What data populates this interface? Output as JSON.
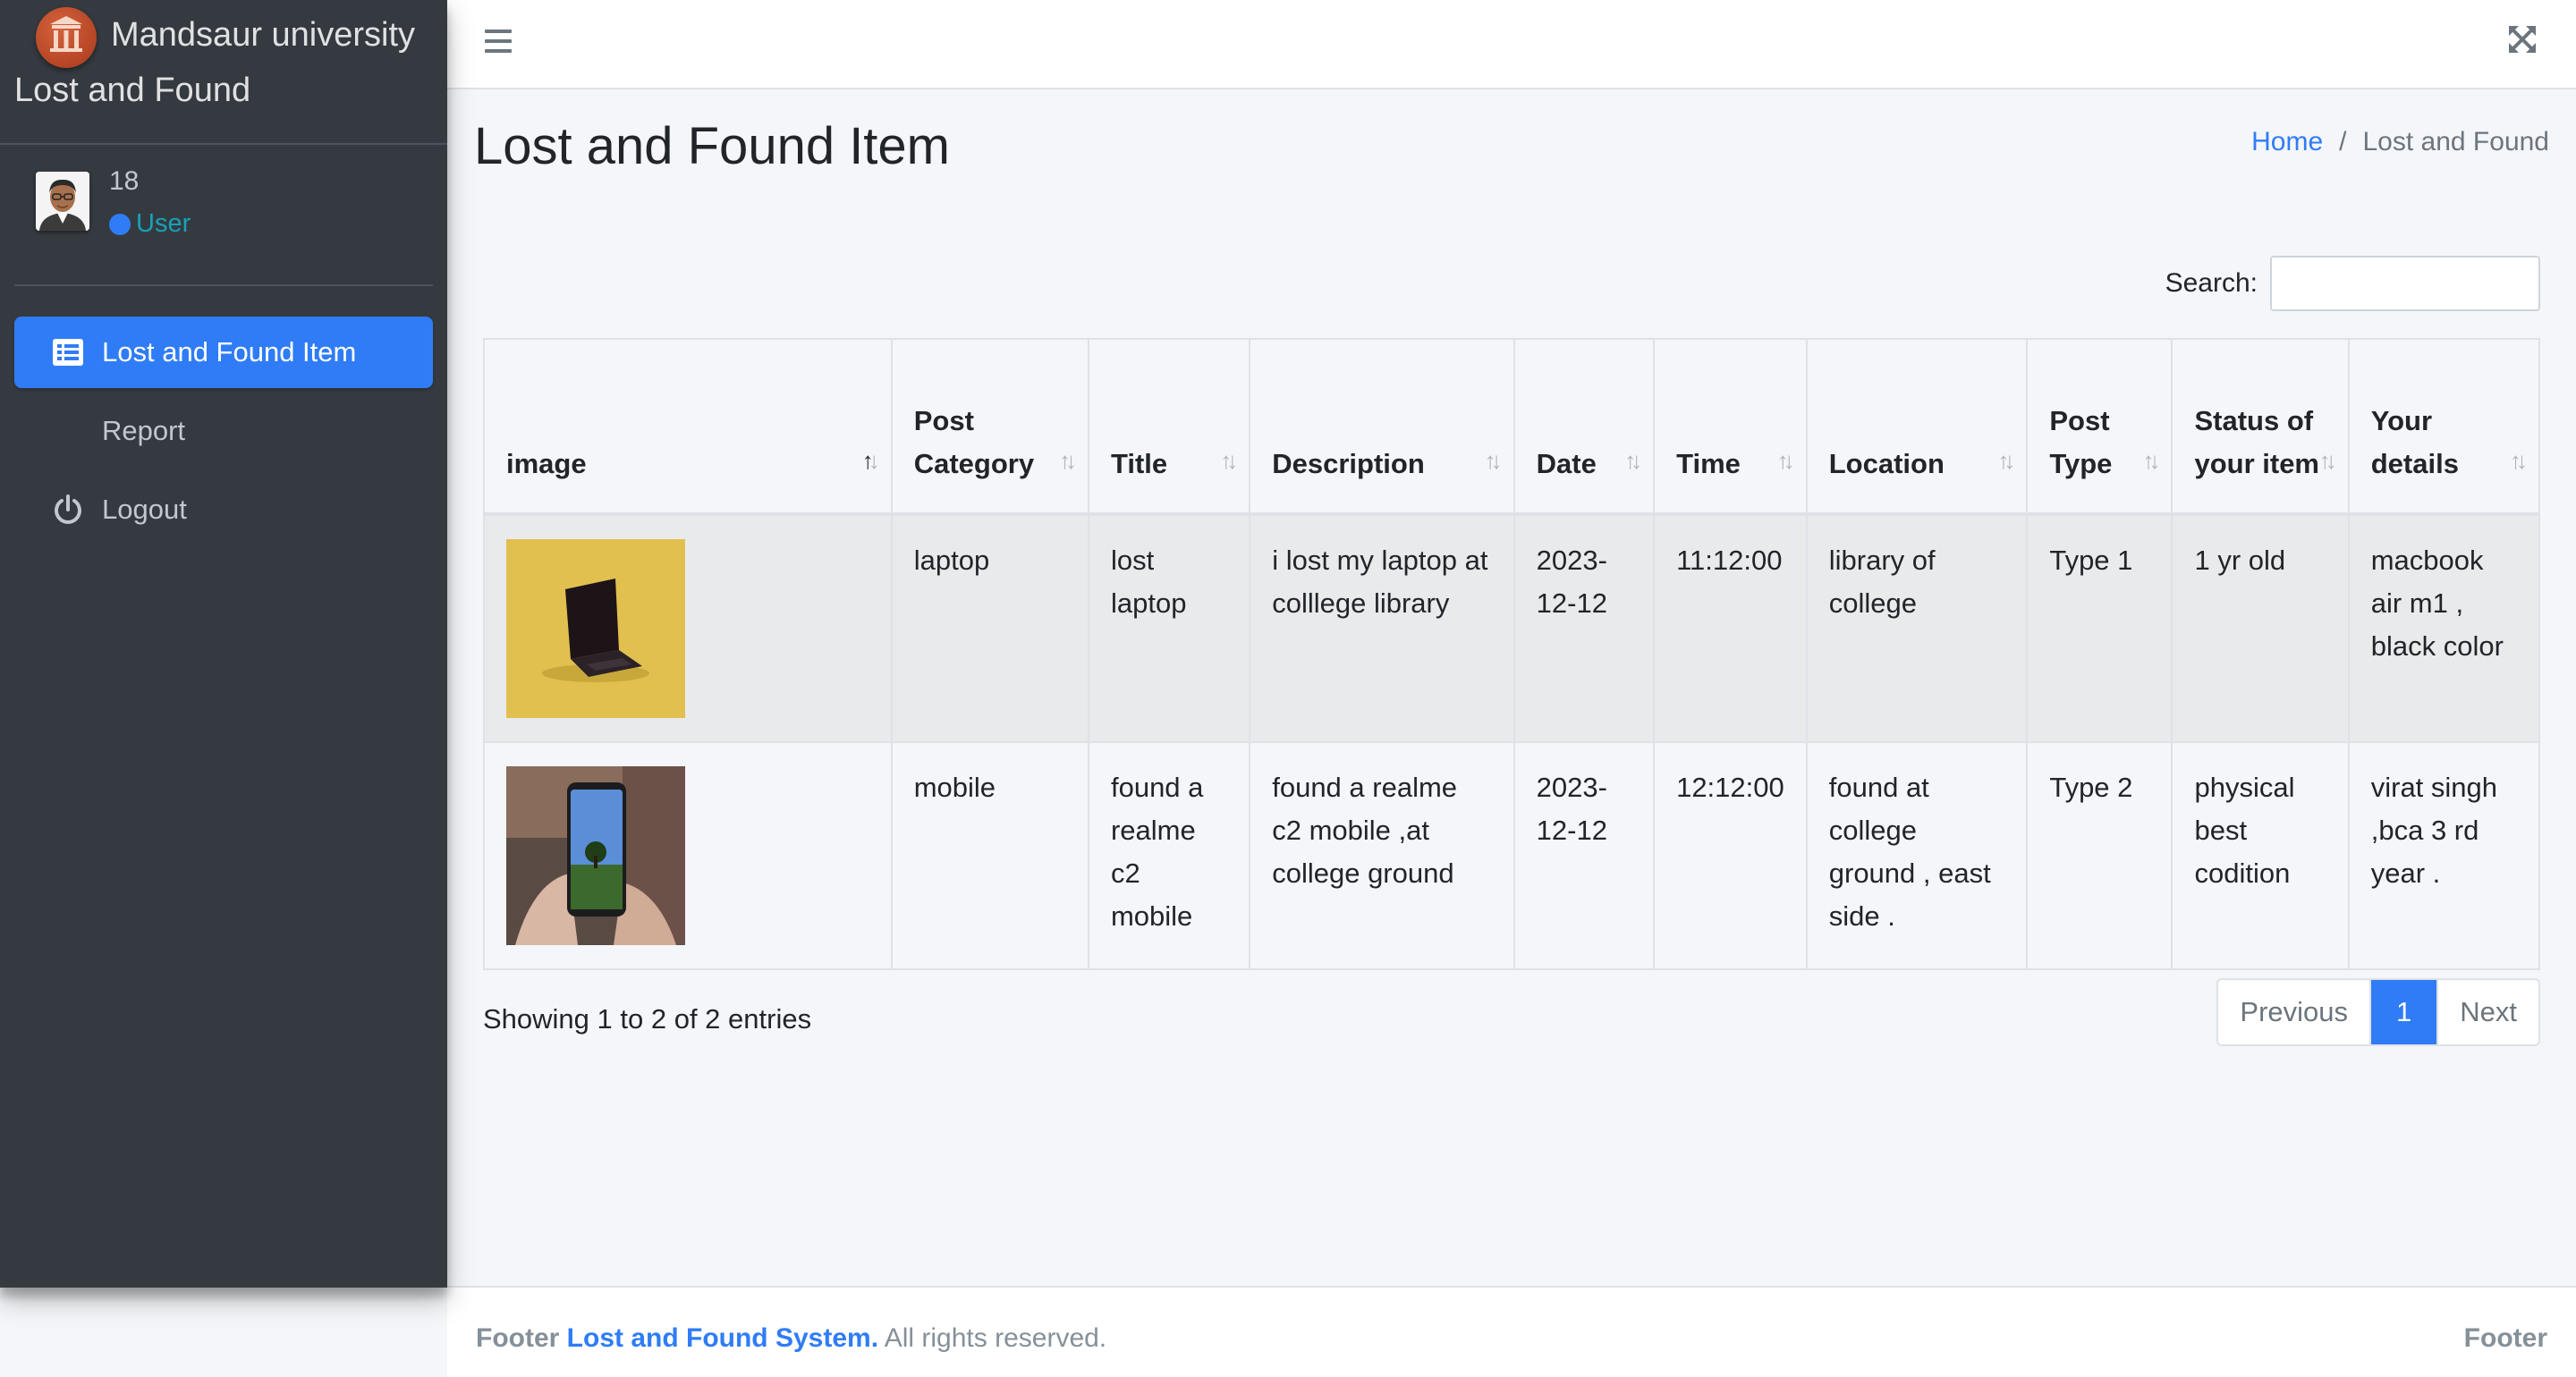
{
  "brand": {
    "name": "Mandsaur university",
    "subtitle": "Lost and Found",
    "logo_icon": "university-logo-icon"
  },
  "user": {
    "name": "18",
    "status": "User"
  },
  "sidebar": {
    "items": [
      {
        "label": "Lost and Found Item",
        "icon": "list-icon",
        "active": true
      },
      {
        "label": "Report",
        "icon": "none",
        "active": false
      },
      {
        "label": "Logout",
        "icon": "power-icon",
        "active": false
      }
    ]
  },
  "page": {
    "title": "Lost and Found Item"
  },
  "breadcrumb": {
    "home": "Home",
    "sep": "/",
    "current": "Lost and Found"
  },
  "search": {
    "label": "Search:",
    "value": "",
    "placeholder": ""
  },
  "table": {
    "headers": [
      "image",
      "Post Category",
      "Title",
      "Description",
      "Date",
      "Time",
      "Location",
      "Post Type",
      "Status of your item",
      "Your details"
    ],
    "rows": [
      {
        "image": "laptop-photo",
        "category": "laptop",
        "title": "lost laptop",
        "description": "i lost my laptop at colllege library",
        "date": "2023-12-12",
        "time": "11:12:00",
        "location": "library of college",
        "post_type": "Type 1",
        "status": "1 yr old",
        "details": "macbook air m1 , black color"
      },
      {
        "image": "mobile-photo",
        "category": "mobile",
        "title": "found a realme c2 mobile",
        "description": "found a realme c2 mobile ,at college ground",
        "date": "2023-12-12",
        "time": "12:12:00",
        "location": "found at college ground , east side .",
        "post_type": "Type 2",
        "status": "physical best codition",
        "details": "virat singh ,bca 3 rd year ."
      }
    ]
  },
  "table_info": "Showing 1 to 2 of 2 entries",
  "pagination": {
    "previous": "Previous",
    "current": "1",
    "next": "Next"
  },
  "footer": {
    "prefix": "Footer",
    "link": "Lost and Found System.",
    "suffix": "All rights reserved.",
    "right": "Footer"
  },
  "colors": {
    "accent": "#2f7cf6",
    "sidebar": "#343a40",
    "background": "#f4f6f9"
  }
}
